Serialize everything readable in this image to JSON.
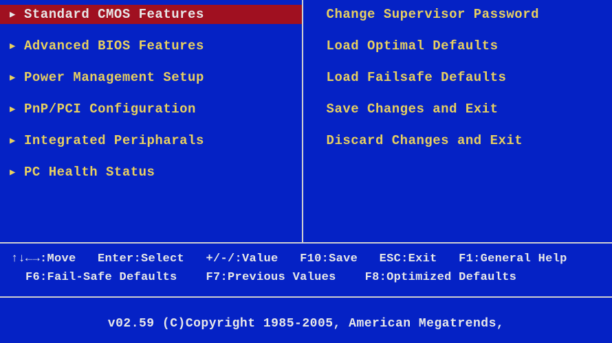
{
  "menu": {
    "left": [
      {
        "label": "Standard CMOS Features",
        "selected": true,
        "hasArrow": true
      },
      {
        "label": "Advanced BIOS Features",
        "selected": false,
        "hasArrow": true
      },
      {
        "label": "Power Management Setup",
        "selected": false,
        "hasArrow": true
      },
      {
        "label": "PnP/PCI Configuration",
        "selected": false,
        "hasArrow": true
      },
      {
        "label": "Integrated Peripharals",
        "selected": false,
        "hasArrow": true
      },
      {
        "label": "PC Health Status",
        "selected": false,
        "hasArrow": true
      }
    ],
    "right": [
      {
        "label": "Change Supervisor Password",
        "selected": false,
        "hasArrow": false
      },
      {
        "label": "Load Optimal Defaults",
        "selected": false,
        "hasArrow": false
      },
      {
        "label": "Load Failsafe Defaults",
        "selected": false,
        "hasArrow": false
      },
      {
        "label": "Save Changes and Exit",
        "selected": false,
        "hasArrow": false
      },
      {
        "label": "Discard Changes and Exit",
        "selected": false,
        "hasArrow": false
      }
    ]
  },
  "help": {
    "row1": "↑↓←→:Move   Enter:Select   +/-/:Value   F10:Save   ESC:Exit   F1:General Help",
    "row2": "  F6:Fail-Safe Defaults    F7:Previous Values    F8:Optimized Defaults"
  },
  "footer": {
    "copyright": "v02.59 (C)Copyright 1985-2005, American Megatrends,"
  }
}
